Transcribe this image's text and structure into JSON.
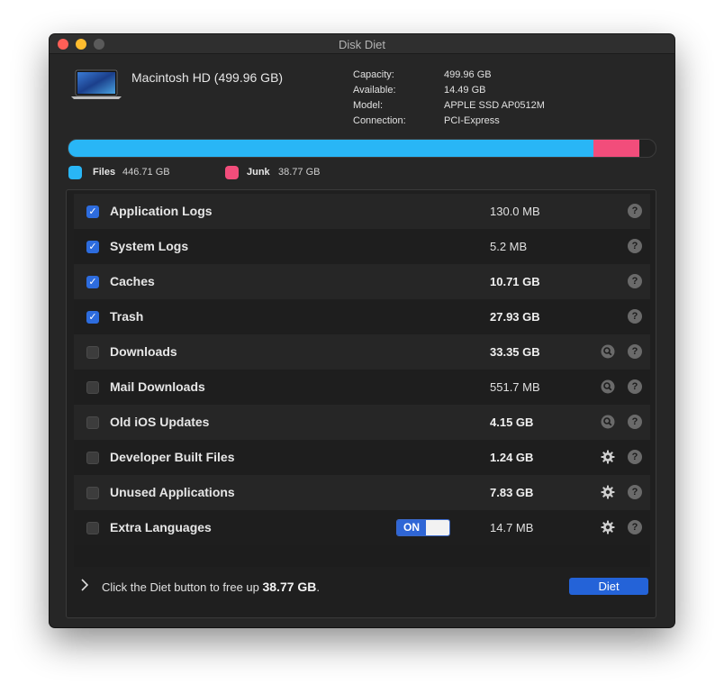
{
  "window": {
    "title": "Disk Diet"
  },
  "disk": {
    "name": "Macintosh HD (499.96 GB)",
    "info": [
      {
        "label": "Capacity:",
        "value": "499.96 GB"
      },
      {
        "label": "Available:",
        "value": "14.49 GB"
      },
      {
        "label": "Model:",
        "value": "APPLE SSD AP0512M"
      },
      {
        "label": "Connection:",
        "value": "PCI-Express"
      }
    ]
  },
  "usage": {
    "files_fraction": 0.8935,
    "junk_fraction": 0.0775,
    "files_color": "#29b6f6",
    "junk_color": "#f24d7b"
  },
  "legend": {
    "files_label": "Files",
    "files_value": "446.71 GB",
    "junk_label": "Junk",
    "junk_value": "38.77 GB"
  },
  "items": [
    {
      "label": "Application Logs",
      "size": "130.0 MB",
      "checked": true,
      "bold_size": false,
      "action": "none"
    },
    {
      "label": "System Logs",
      "size": "5.2 MB",
      "checked": true,
      "bold_size": false,
      "action": "none"
    },
    {
      "label": "Caches",
      "size": "10.71 GB",
      "checked": true,
      "bold_size": true,
      "action": "none"
    },
    {
      "label": "Trash",
      "size": "27.93 GB",
      "checked": true,
      "bold_size": true,
      "action": "none"
    },
    {
      "label": "Downloads",
      "size": "33.35 GB",
      "checked": false,
      "bold_size": true,
      "action": "magnifier-icon"
    },
    {
      "label": "Mail Downloads",
      "size": "551.7 MB",
      "checked": false,
      "bold_size": false,
      "action": "magnifier-icon"
    },
    {
      "label": "Old iOS Updates",
      "size": "4.15 GB",
      "checked": false,
      "bold_size": true,
      "action": "magnifier-icon"
    },
    {
      "label": "Developer Built Files",
      "size": "1.24 GB",
      "checked": false,
      "bold_size": true,
      "action": "gear-icon"
    },
    {
      "label": "Unused Applications",
      "size": "7.83 GB",
      "checked": false,
      "bold_size": true,
      "action": "gear-icon"
    },
    {
      "label": "Extra Languages",
      "size": "14.7 MB",
      "checked": false,
      "bold_size": false,
      "action": "gear-icon",
      "toggle": "ON"
    }
  ],
  "help_glyph": "?",
  "check_glyph": "✓",
  "footer": {
    "text_prefix": "Click the Diet button to free up ",
    "amount": "38.77 GB",
    "text_suffix": ".",
    "button_label": "Diet"
  }
}
